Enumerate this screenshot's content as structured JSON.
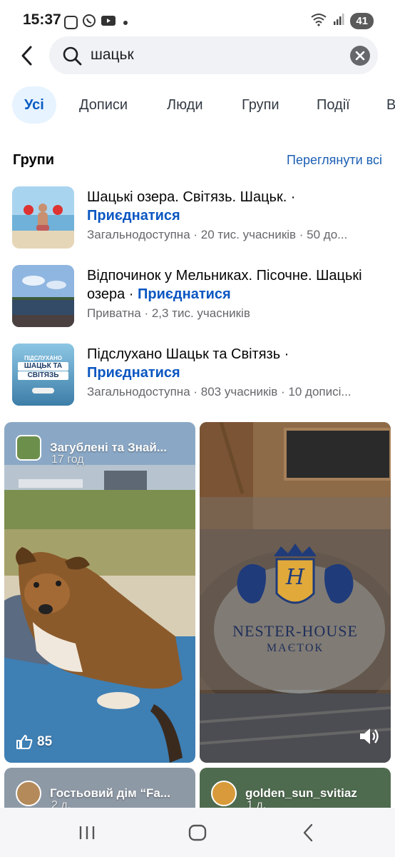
{
  "status_bar": {
    "time": "15:37",
    "battery": "41",
    "icons_left": [
      "screenshot-icon",
      "viber-icon",
      "youtube-icon",
      "dot-icon"
    ],
    "icons_right": [
      "wifi-icon",
      "signal-icon",
      "battery-icon"
    ]
  },
  "search": {
    "query": "шацьк",
    "placeholder": ""
  },
  "tabs": [
    {
      "label": "Усі",
      "active": true
    },
    {
      "label": "Дописи",
      "active": false
    },
    {
      "label": "Люди",
      "active": false
    },
    {
      "label": "Групи",
      "active": false
    },
    {
      "label": "Події",
      "active": false
    },
    {
      "label": "В",
      "active": false
    }
  ],
  "groups_section": {
    "title": "Групи",
    "see_all": "Переглянути всі",
    "items": [
      {
        "title": "Шацькі озера. Світязь. Шацьк.",
        "separator": " · ",
        "join": "Приєднатися",
        "meta": "Загальнодоступна · 20 тис. учасників · 50 до..."
      },
      {
        "title": "Відпочинок у Мельниках. Пісочне. Шацькі озера",
        "separator": " · ",
        "join": "Приєднатися",
        "meta": "Приватна · 2,3 тис. учасників"
      },
      {
        "title": "Підслухано Шацьк та Світязь",
        "separator": " · ",
        "join": "Приєднатися",
        "meta": "Загальнодоступна · 803 учасників · 10 дописі..."
      }
    ]
  },
  "thumb3_text": {
    "line1": "ПІДСЛУХАНО",
    "line2": "ШАЦЬК ТА",
    "line3": "СВІТЯЗЬ"
  },
  "cards": [
    {
      "name": "Загублені  та Знай...",
      "time": "17 год",
      "likes": "85"
    },
    {
      "brand": "NESTER-HOUSE",
      "sub": "МАЄТОК",
      "monogram": "H"
    },
    {
      "name": "Гостьовий дім “Fa...",
      "time": "2 д."
    },
    {
      "name": "golden_sun_svitiaz",
      "time": "1 д."
    }
  ],
  "colors": {
    "accent": "#0a56c2",
    "tab_active_bg": "#e7f3ff",
    "meta_text": "#65676b"
  }
}
